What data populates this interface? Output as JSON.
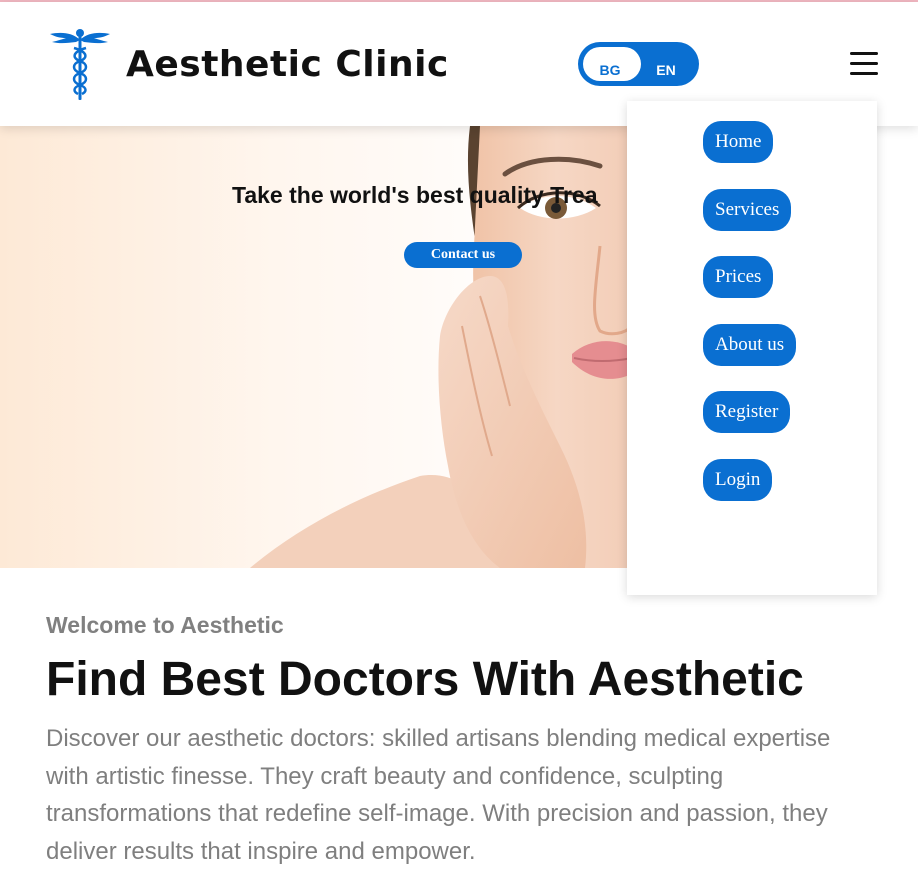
{
  "header": {
    "logo_text": "Aesthetic Clinic",
    "lang_toggle": {
      "options": [
        "BG",
        "EN"
      ],
      "selected": "BG"
    },
    "menu_icon": "hamburger-icon"
  },
  "hero": {
    "title": "Take the world's best quality Trea",
    "contact_button": "Contact us"
  },
  "nav_menu": {
    "items": [
      {
        "label": "Home"
      },
      {
        "label": "Services"
      },
      {
        "label": "Prices"
      },
      {
        "label": "About us"
      },
      {
        "label": "Register"
      },
      {
        "label": "Login"
      }
    ]
  },
  "content": {
    "welcome": "Welcome to Aesthetic",
    "title": "Find Best Doctors With Aesthetic",
    "description": "Discover our aesthetic doctors: skilled artisans blending medical expertise with artistic finesse. They craft beauty and confidence, sculpting transformations that redefine self-image. With precision and passion, they deliver results that inspire and empower."
  },
  "colors": {
    "accent": "#0a6fd1",
    "text_dark": "#111111",
    "text_muted": "#7f7f7f"
  }
}
